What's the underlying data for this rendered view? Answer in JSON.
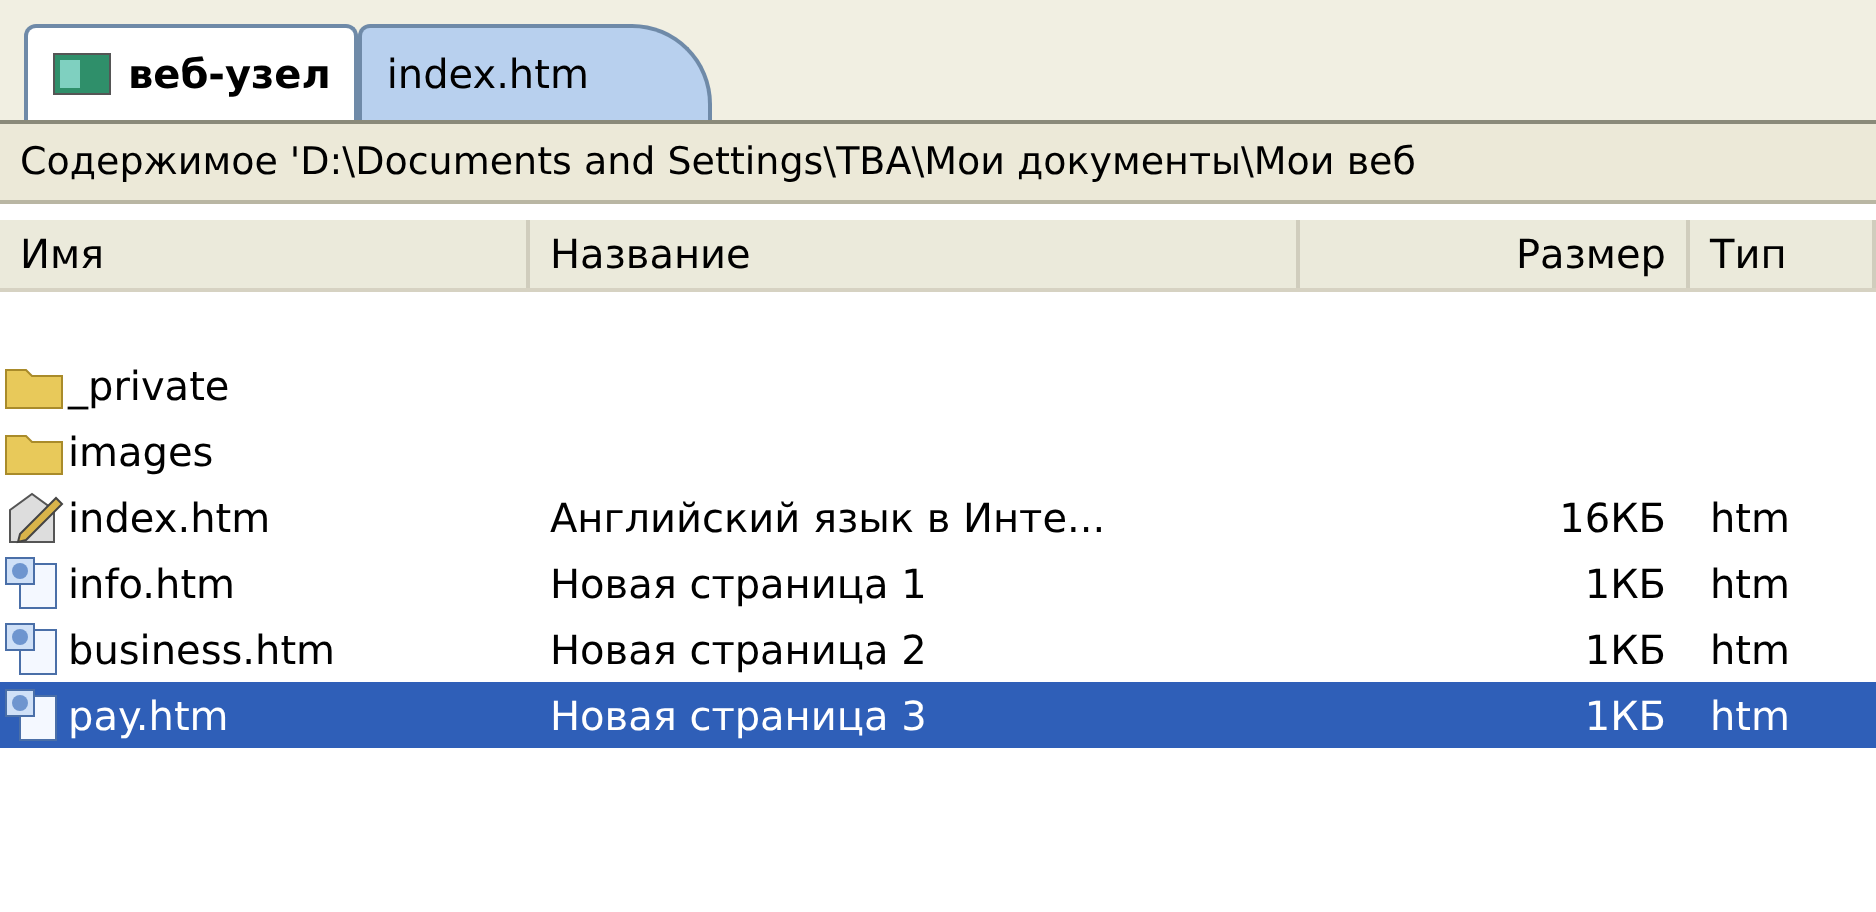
{
  "tabs": [
    {
      "label": "веб-узел",
      "kind": "site",
      "selected": true
    },
    {
      "label": "index.htm",
      "kind": "file",
      "selected": false
    }
  ],
  "path_bar": "Содержимое 'D:\\Documents and Settings\\ТВА\\Мои документы\\Мои веб",
  "table": {
    "columns": [
      "Имя",
      "Название",
      "Размер",
      "Тип"
    ],
    "rows": [
      {
        "kind": "folder",
        "name": "_private",
        "selected": false
      },
      {
        "kind": "folder",
        "name": "images",
        "selected": false
      },
      {
        "kind": "edit-page",
        "name": "index.htm",
        "title": "Английский язык в Инте...",
        "size": "16КБ",
        "type": "htm",
        "selected": false
      },
      {
        "kind": "page",
        "name": "info.htm",
        "title": "Новая страница 1",
        "size": "1КБ",
        "type": "htm",
        "selected": false
      },
      {
        "kind": "page",
        "name": "business.htm",
        "title": "Новая страница 2",
        "size": "1КБ",
        "type": "htm",
        "selected": false
      },
      {
        "kind": "page",
        "name": "pay.htm",
        "title": "Новая страница 3",
        "size": "1КБ",
        "type": "htm",
        "selected": true
      }
    ]
  }
}
